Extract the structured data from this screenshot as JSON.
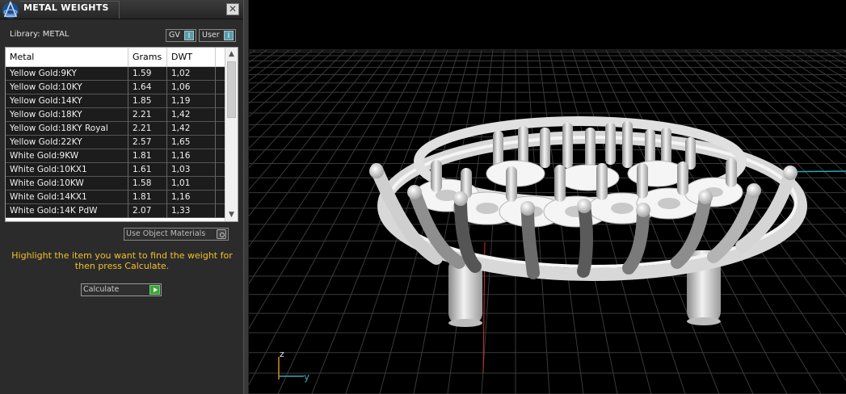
{
  "panel": {
    "title": "METAL WEIGHTS",
    "close_glyph": "✕",
    "library_label": "Library: METAL",
    "toggles": {
      "gv": {
        "label": "GV",
        "value": "I"
      },
      "user": {
        "label": "User",
        "value": "I"
      }
    },
    "table": {
      "headers": {
        "metal": "Metal",
        "grams": "Grams",
        "dwt": "DWT"
      },
      "rows": [
        {
          "metal": "Yellow Gold:9KY",
          "grams": "1.59",
          "dwt": "1,02"
        },
        {
          "metal": "Yellow Gold:10KY",
          "grams": "1.64",
          "dwt": "1,06"
        },
        {
          "metal": "Yellow Gold:14KY",
          "grams": "1.85",
          "dwt": "1,19"
        },
        {
          "metal": "Yellow Gold:18KY",
          "grams": "2.21",
          "dwt": "1,42"
        },
        {
          "metal": "Yellow Gold:18KY Royal",
          "grams": "2.21",
          "dwt": "1,42"
        },
        {
          "metal": "Yellow Gold:22KY",
          "grams": "2.57",
          "dwt": "1,65"
        },
        {
          "metal": "White Gold:9KW",
          "grams": "1.81",
          "dwt": "1,16"
        },
        {
          "metal": "White Gold:10KX1",
          "grams": "1.61",
          "dwt": "1,03"
        },
        {
          "metal": "White Gold:10KW",
          "grams": "1.58",
          "dwt": "1,01"
        },
        {
          "metal": "White Gold:14KX1",
          "grams": "1.81",
          "dwt": "1,16"
        },
        {
          "metal": "White Gold:14K PdW",
          "grams": "2.07",
          "dwt": "1,33"
        }
      ]
    },
    "use_object_materials_label": "Use Object Materials",
    "hint_text": "Highlight the item you want to find the weight for then press Calculate.",
    "calculate_label": "Calculate"
  },
  "viewport": {
    "axes": {
      "z_label": "z",
      "y_label": "y"
    },
    "colors": {
      "grid": "#3a3a3a",
      "axis_red": "#c0392b",
      "axis_cyan": "#2aa7b0",
      "background": "#000000"
    }
  }
}
